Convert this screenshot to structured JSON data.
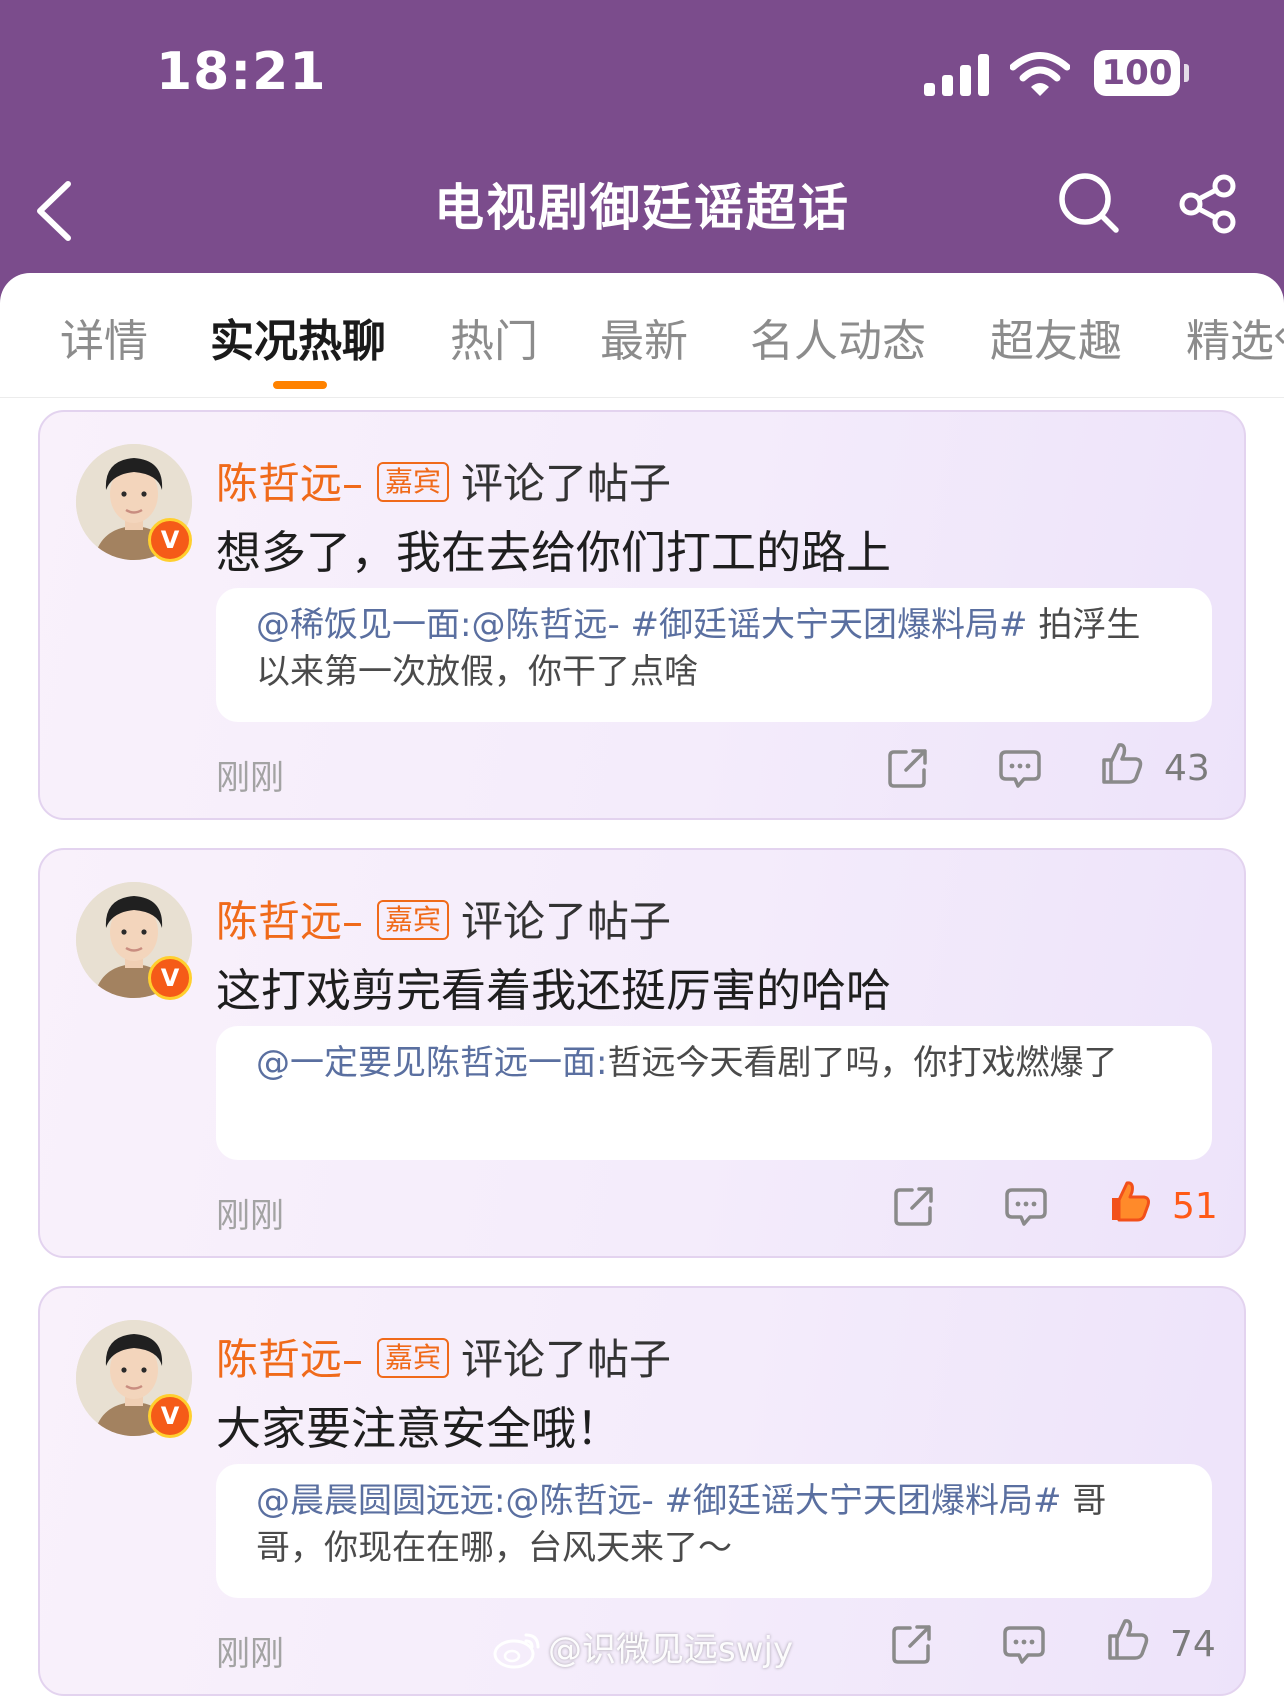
{
  "status_bar": {
    "time": "18:21",
    "battery": "100"
  },
  "header": {
    "title": "电视剧御廷谣超话"
  },
  "tabs": [
    {
      "label": "详情"
    },
    {
      "label": "实况热聊"
    },
    {
      "label": "热门"
    },
    {
      "label": "最新"
    },
    {
      "label": "名人动态"
    },
    {
      "label": "超友趣"
    },
    {
      "label": "精选"
    }
  ],
  "posts": [
    {
      "author": "陈哲远–",
      "badge": "嘉宾",
      "action": "评论了帖子",
      "verified": "V",
      "comment": "想多了，我在去给你们打工的路上",
      "quote_user": "@稀饭见一面:",
      "quote_mention": "@陈哲远- #御廷谣大宁天团爆料局#",
      "quote_text": " 拍浮生以来第一次放假，你干了点啥",
      "time": "刚刚",
      "likes": "43",
      "liked": false
    },
    {
      "author": "陈哲远–",
      "badge": "嘉宾",
      "action": "评论了帖子",
      "verified": "V",
      "comment": "这打戏剪完看着我还挺厉害的哈哈",
      "quote_user": "@一定要见陈哲远一面:",
      "quote_mention": "",
      "quote_text": "哲远今天看剧了吗，你打戏燃爆了",
      "time": "刚刚",
      "likes": "51",
      "liked": true
    },
    {
      "author": "陈哲远–",
      "badge": "嘉宾",
      "action": "评论了帖子",
      "verified": "V",
      "comment": "大家要注意安全哦！",
      "quote_user": "@晨晨圆圆远远:",
      "quote_mention": "@陈哲远- #御廷谣大宁天团爆料局#",
      "quote_text": " 哥哥，你现在在哪，台风天来了～",
      "time": "刚刚",
      "likes": "74",
      "liked": false
    }
  ],
  "watermark": "@识微见远swjy",
  "colors": {
    "header_bg": "#7b4c8c",
    "accent": "#ff8200",
    "author": "#f06a1a",
    "liked": "#ff5a17",
    "mention": "#5a6fa0"
  },
  "icons": [
    "back-icon",
    "search-icon",
    "share-icon",
    "repost-icon",
    "comment-icon",
    "like-icon",
    "verified-icon",
    "weibo-logo-icon"
  ]
}
